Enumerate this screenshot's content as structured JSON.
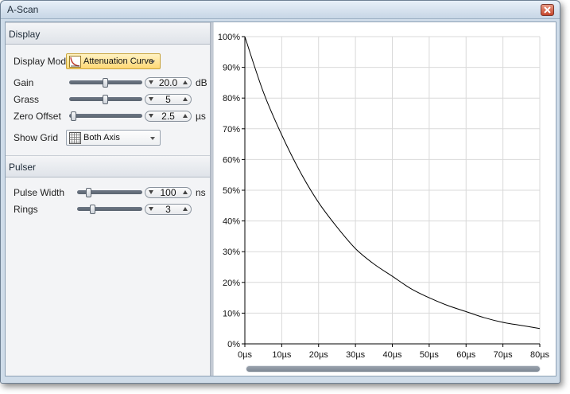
{
  "window": {
    "title": "A-Scan"
  },
  "display": {
    "header": "Display",
    "display_mode": {
      "label": "Display Mode",
      "value": "Attenuation Curve",
      "icon": "curve-icon"
    },
    "gain": {
      "label": "Gain",
      "value": "20.0",
      "unit": "dB"
    },
    "grass": {
      "label": "Grass",
      "value": "5"
    },
    "zero_offset": {
      "label": "Zero Offset",
      "value": "2.5",
      "unit": "µs"
    },
    "show_grid": {
      "label": "Show Grid",
      "value": "Both Axis",
      "icon": "grid-icon"
    }
  },
  "pulser": {
    "header": "Pulser",
    "pulse_width": {
      "label": "Pulse Width",
      "value": "100",
      "unit": "ns"
    },
    "rings": {
      "label": "Rings",
      "value": "3"
    }
  },
  "chart_data": {
    "type": "line",
    "title": "",
    "xlabel": "",
    "ylabel": "",
    "x_ticks": [
      "0µs",
      "10µs",
      "20µs",
      "30µs",
      "40µs",
      "50µs",
      "60µs",
      "70µs",
      "80µs"
    ],
    "y_ticks": [
      "0%",
      "10%",
      "20%",
      "30%",
      "40%",
      "50%",
      "60%",
      "70%",
      "80%",
      "90%",
      "100%"
    ],
    "xlim": [
      0,
      80
    ],
    "ylim": [
      0,
      100
    ],
    "grid": true,
    "series": [
      {
        "x": [
          0,
          5,
          10,
          15,
          20,
          25,
          30,
          35,
          40,
          45,
          50,
          55,
          60,
          65,
          70,
          75,
          80
        ],
        "y": [
          100,
          82,
          68,
          56,
          46,
          38,
          31,
          26,
          22,
          18,
          15,
          12.5,
          10.5,
          8.5,
          7,
          6,
          5
        ]
      }
    ]
  }
}
